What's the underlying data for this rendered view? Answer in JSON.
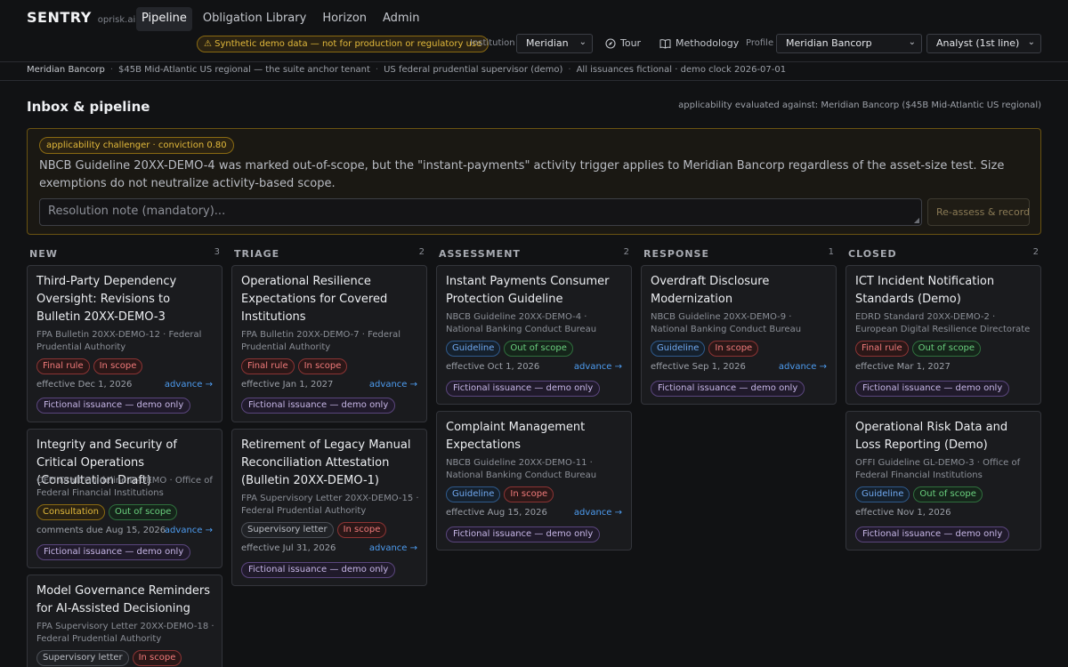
{
  "app": {
    "name": "SENTRY",
    "subtitle": "oprisk.ai"
  },
  "nav": {
    "tabs": [
      {
        "label": "Pipeline",
        "active": true
      },
      {
        "label": "Obligation Library",
        "active": false
      },
      {
        "label": "Horizon",
        "active": false
      },
      {
        "label": "Admin",
        "active": false
      }
    ]
  },
  "toolbar": {
    "warning": "⚠ Synthetic demo data — not for production or regulatory use",
    "institution_label": "Institution",
    "institution_value": "Meridian",
    "tour_label": "Tour",
    "tour_icon": "compass-icon",
    "methodology_label": "Methodology",
    "methodology_icon": "book-icon",
    "profile_label": "Profile",
    "profile_value": "Meridian Bancorp",
    "role_value": "Analyst (1st line)"
  },
  "breadcrumb": {
    "items": [
      "Meridian Bancorp",
      "$45B Mid-Atlantic US regional — the suite anchor tenant",
      "US federal prudential supervisor (demo)",
      "All issuances fictional · demo clock 2026-07-01"
    ]
  },
  "main": {
    "title": "Inbox & pipeline",
    "applicability_note": "applicability evaluated against: Meridian Bancorp ($45B Mid-Atlantic US regional)"
  },
  "challenger": {
    "badge": "applicability challenger · conviction 0.80",
    "text": "NBCB Guideline 20XX-DEMO-4 was marked out-of-scope, but the \"instant-payments\" activity trigger applies to Meridian Bancorp regardless of the asset-size test. Size exemptions do not neutralize activity-based scope.",
    "input_placeholder": "Resolution note (mandatory)...",
    "button_label": "Re-assess & record"
  },
  "colors": {
    "accent_link": "#4d9cf0",
    "warning": "#e2b93b",
    "danger": "#f07a7a",
    "success": "#6ad07e"
  },
  "columns": [
    {
      "title": "NEW",
      "count": "3",
      "cards": [
        {
          "title": "Third-Party Dependency Oversight: Revisions to Bulletin 20XX-DEMO-3",
          "meta": "FPA Bulletin 20XX-DEMO-12 · Federal Prudential Authority",
          "type": "Final rule",
          "scope": "In scope",
          "effective": "effective Dec 1, 2026",
          "advance": "advance →",
          "tag": "Fictional issuance — demo only"
        },
        {
          "title": "Integrity and Security of Critical Operations (Consultation Draft)",
          "meta": "OFFI Draft Guideline D-DEMO · Office of Federal Financial Institutions",
          "type": "Consultation",
          "scope": "Out of scope",
          "effective": "comments due Aug 15, 2026",
          "advance": "advance →",
          "tag": "Fictional issuance — demo only"
        },
        {
          "title": "Model Governance Reminders for AI-Assisted Decisioning",
          "meta": "FPA Supervisory Letter 20XX-DEMO-18 · Federal Prudential Authority",
          "type": "Supervisory letter",
          "scope": "In scope",
          "effective": "",
          "advance": "",
          "tag": ""
        }
      ]
    },
    {
      "title": "TRIAGE",
      "count": "2",
      "cards": [
        {
          "title": "Operational Resilience Expectations for Covered Institutions",
          "meta": "FPA Bulletin 20XX-DEMO-7 · Federal Prudential Authority",
          "type": "Final rule",
          "scope": "In scope",
          "effective": "effective Jan 1, 2027",
          "advance": "advance →",
          "tag": "Fictional issuance — demo only"
        },
        {
          "title": "Retirement of Legacy Manual Reconciliation Attestation (Bulletin 20XX-DEMO-1)",
          "meta": "FPA Supervisory Letter 20XX-DEMO-15 · Federal Prudential Authority",
          "type": "Supervisory letter",
          "scope": "In scope",
          "effective": "effective Jul 31, 2026",
          "advance": "advance →",
          "tag": "Fictional issuance — demo only"
        }
      ]
    },
    {
      "title": "ASSESSMENT",
      "count": "2",
      "cards": [
        {
          "title": "Instant Payments Consumer Protection Guideline",
          "meta": "NBCB Guideline 20XX-DEMO-4 · National Banking Conduct Bureau",
          "type": "Guideline",
          "scope": "Out of scope",
          "effective": "effective Oct 1, 2026",
          "advance": "advance →",
          "tag": "Fictional issuance — demo only"
        },
        {
          "title": "Complaint Management Expectations",
          "meta": "NBCB Guideline 20XX-DEMO-11 · National Banking Conduct Bureau",
          "type": "Guideline",
          "scope": "In scope",
          "effective": "effective Aug 15, 2026",
          "advance": "advance →",
          "tag": "Fictional issuance — demo only"
        }
      ]
    },
    {
      "title": "RESPONSE",
      "count": "1",
      "cards": [
        {
          "title": "Overdraft Disclosure Modernization",
          "meta": "NBCB Guideline 20XX-DEMO-9 · National Banking Conduct Bureau",
          "type": "Guideline",
          "scope": "In scope",
          "effective": "effective Sep 1, 2026",
          "advance": "advance →",
          "tag": "Fictional issuance — demo only"
        }
      ]
    },
    {
      "title": "CLOSED",
      "count": "2",
      "cards": [
        {
          "title": "ICT Incident Notification Standards (Demo)",
          "meta": "EDRD Standard 20XX-DEMO-2 · European Digital Resilience Directorate",
          "type": "Final rule",
          "scope": "Out of scope",
          "effective": "effective Mar 1, 2027",
          "advance": "",
          "tag": "Fictional issuance — demo only"
        },
        {
          "title": "Operational Risk Data and Loss Reporting (Demo)",
          "meta": "OFFI Guideline GL-DEMO-3 · Office of Federal Financial Institutions",
          "type": "Guideline",
          "scope": "Out of scope",
          "effective": "effective Nov 1, 2026",
          "advance": "",
          "tag": "Fictional issuance — demo only"
        }
      ]
    }
  ]
}
